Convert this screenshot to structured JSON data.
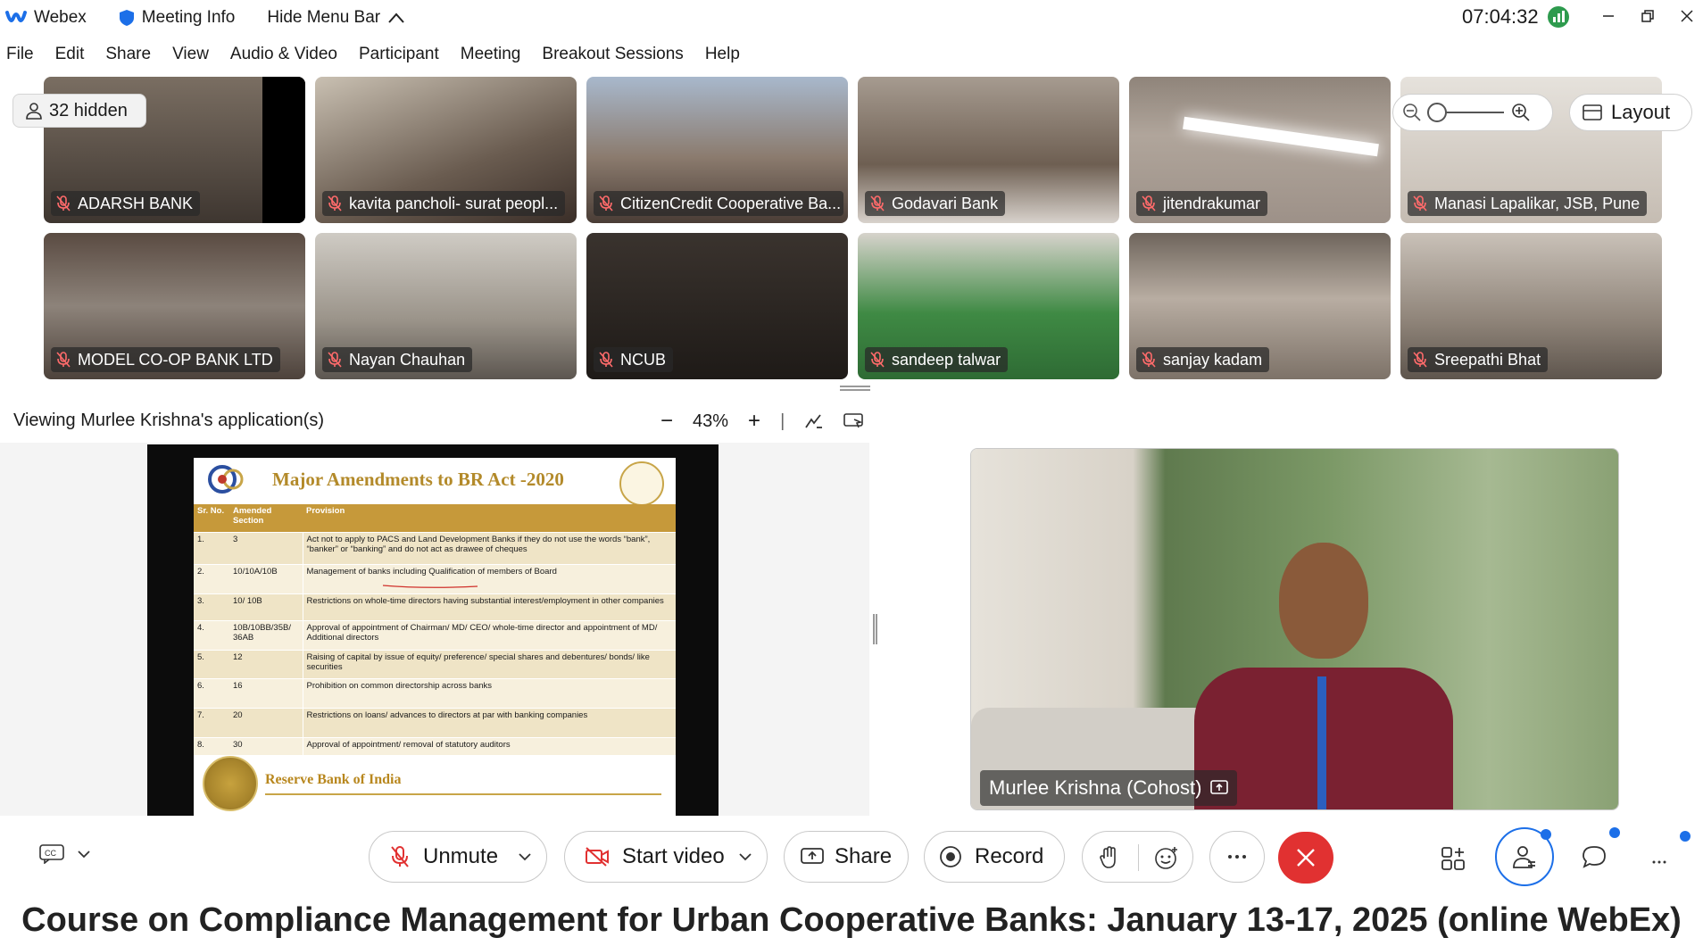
{
  "titlebar": {
    "app_name": "Webex",
    "meeting_info": "Meeting Info",
    "hide_menu_bar": "Hide Menu Bar",
    "time": "07:04:32"
  },
  "menu": [
    "File",
    "Edit",
    "Share",
    "View",
    "Audio & Video",
    "Participant",
    "Meeting",
    "Breakout Sessions",
    "Help"
  ],
  "hidden_count": "32 hidden",
  "layout_label": "Layout",
  "participants": [
    {
      "name": "ADARSH BANK",
      "bg": "#5a5148"
    },
    {
      "name": "kavita pancholi- surat peopl...",
      "bg": "#8a7e70"
    },
    {
      "name": "CitizenCredit Cooperative Ba...",
      "bg": "#8fa0b4"
    },
    {
      "name": "Godavari Bank",
      "bg": "#9a8f86"
    },
    {
      "name": "jitendrakumar",
      "bg": "#b8aca2"
    },
    {
      "name": "Manasi Lapalikar, JSB, Pune",
      "bg": "#d6cfc8"
    },
    {
      "name": "MODEL CO-OP BANK LTD",
      "bg": "#6d625a"
    },
    {
      "name": "Nayan Chauhan",
      "bg": "#b5b0a6"
    },
    {
      "name": "NCUB",
      "bg": "#2b2622"
    },
    {
      "name": "sandeep talwar",
      "bg": "#4f7d4a"
    },
    {
      "name": "sanjay kadam",
      "bg": "#8e8478"
    },
    {
      "name": "Sreepathi Bhat",
      "bg": "#a59a90"
    }
  ],
  "share": {
    "viewing": "Viewing Murlee Krishna's application(s)",
    "zoom": "43%"
  },
  "slide": {
    "title": "Major Amendments to BR Act -2020",
    "headers": [
      "Sr. No.",
      "Amended Section",
      "Provision"
    ],
    "rows": [
      {
        "no": "1.",
        "section": "3",
        "provision": "Act not to apply to PACS and Land Development Banks if they do not use the words “bank”, “banker” or “banking” and do not act as drawee of cheques"
      },
      {
        "no": "2.",
        "section": "10/10A/10B",
        "provision": "Management of banks including Qualification of members of Board"
      },
      {
        "no": "3.",
        "section": "10/ 10B",
        "provision": "Restrictions on whole-time directors having substantial interest/employment in other companies"
      },
      {
        "no": "4.",
        "section": "10B/10BB/35B/ 36AB",
        "provision": "Approval of appointment of Chairman/ MD/ CEO/ whole-time director and appointment of MD/ Additional directors"
      },
      {
        "no": "5.",
        "section": "12",
        "provision": "Raising of capital by issue of equity/ preference/ special shares and debentures/ bonds/ like securities"
      },
      {
        "no": "6.",
        "section": "16",
        "provision": "Prohibition on common directorship across banks"
      },
      {
        "no": "7.",
        "section": "20",
        "provision": "Restrictions on loans/ advances to directors at par with banking companies"
      },
      {
        "no": "8.",
        "section": "30",
        "provision": "Approval of appointment/ removal of statutory auditors"
      }
    ],
    "footer": "Reserve Bank of India"
  },
  "speaker": {
    "name": "Murlee Krishna (Cohost)"
  },
  "controls": {
    "unmute": "Unmute",
    "start_video": "Start video",
    "share": "Share",
    "record": "Record"
  },
  "caption": "Course on Compliance Management for Urban Cooperative Banks: January 13-17, 2025 (online WebEx)",
  "colors": {
    "accent": "#1c6fe8",
    "end_call": "#e13131",
    "slide_gold": "#c6993a"
  }
}
